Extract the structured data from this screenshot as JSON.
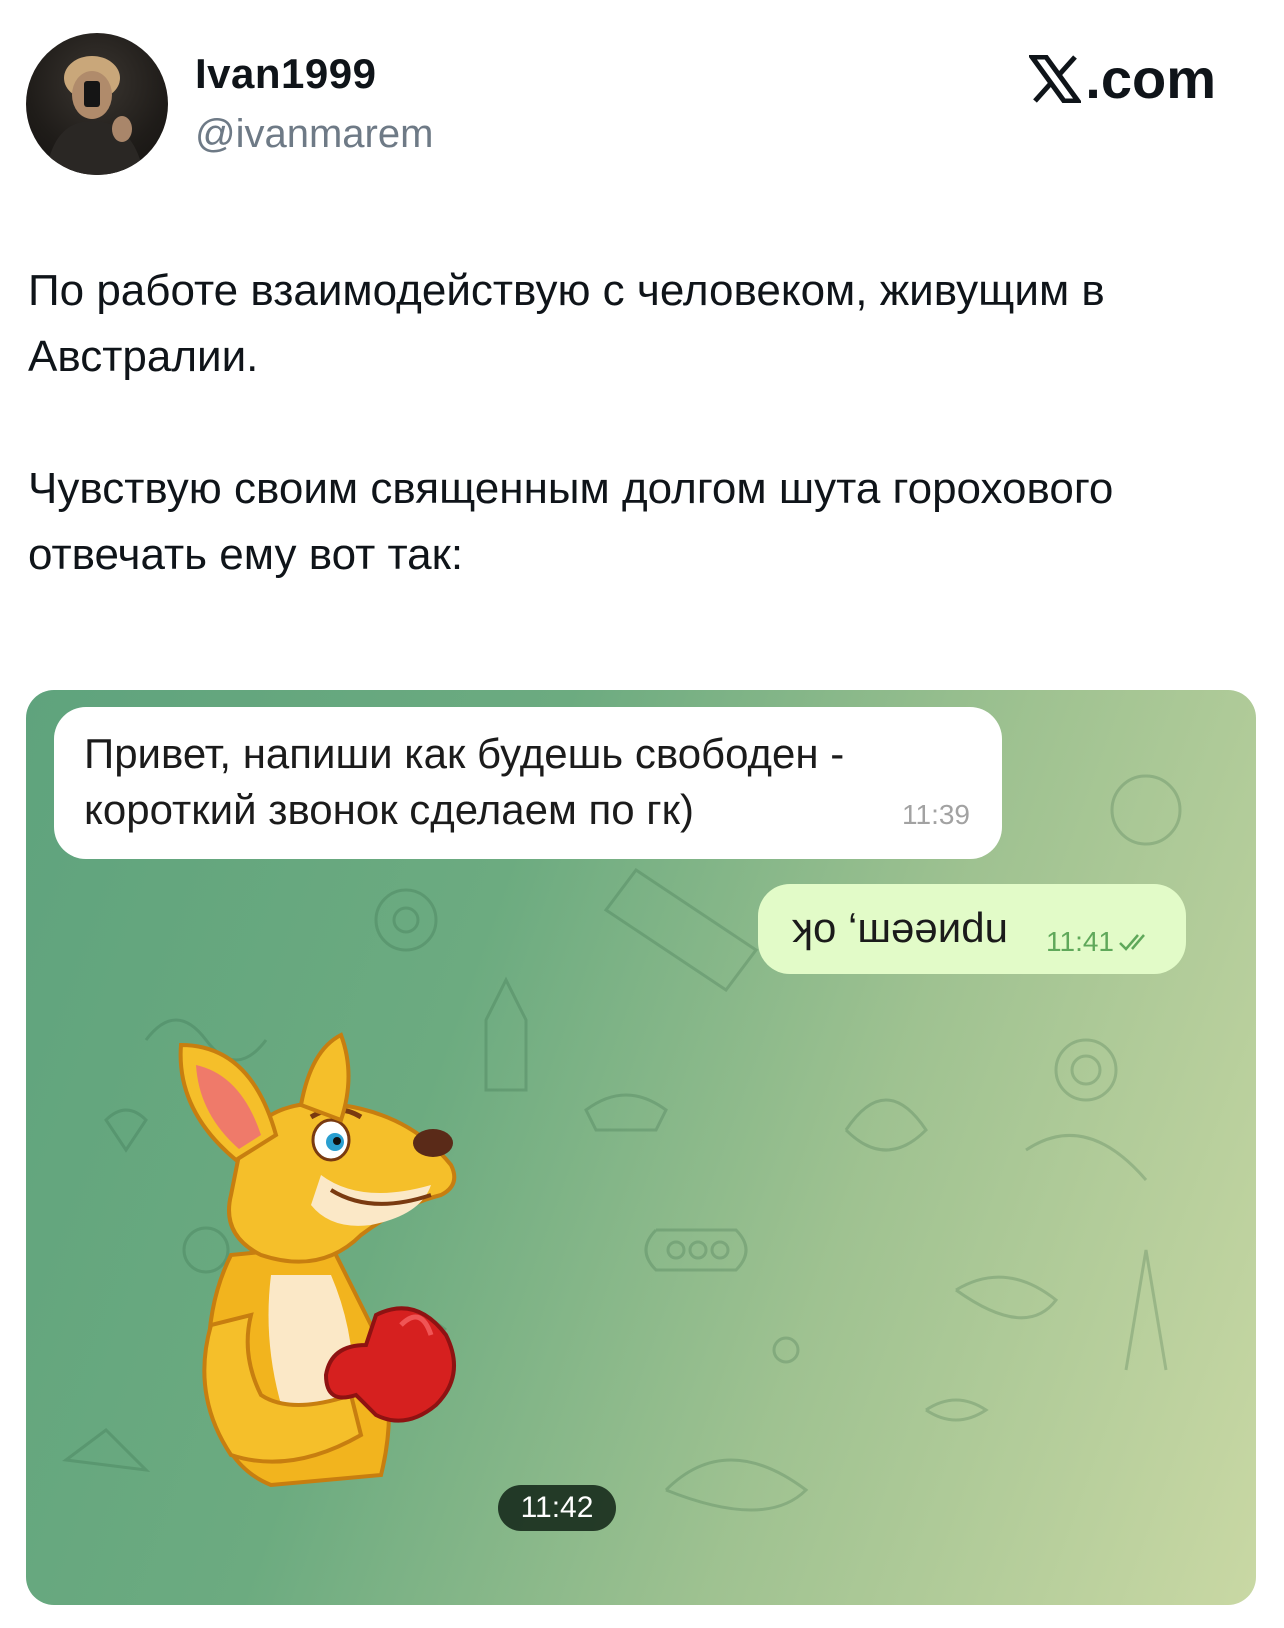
{
  "author": {
    "display_name": "Ivan1999",
    "handle": "@ivanmarem"
  },
  "brand": {
    "label": ".com",
    "icon": "x-logo-icon"
  },
  "tweet": {
    "paragraphs": [
      "По работе взаимодействую с человеком, живущим в Австралии.",
      "Чувствую своим священным долгом шута горохового отвечать ему вот так:"
    ]
  },
  "chat": {
    "incoming": {
      "text": "Привет, напиши как будешь свободен - короткий звонок сделаем по гк)",
      "time": "11:39"
    },
    "outgoing": {
      "text": "ʞо ‘шәǝиdu",
      "time": "11:41",
      "status_icon": "double-check-icon"
    },
    "sticker": {
      "icon": "kangaroo-boxing-sticker",
      "time": "11:42"
    },
    "colors": {
      "incoming_bubble": "#ffffff",
      "outgoing_bubble": "#e2fbc8",
      "read_check": "#5fa85a"
    }
  }
}
